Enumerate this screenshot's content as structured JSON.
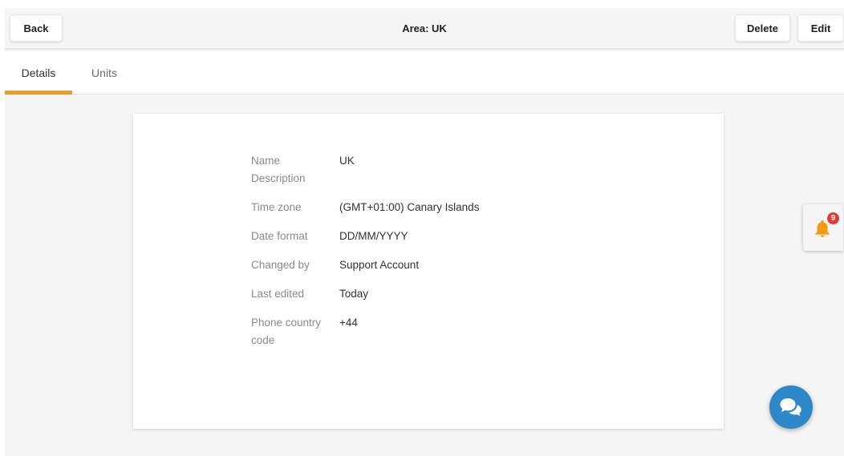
{
  "header": {
    "back_label": "Back",
    "title": "Area: UK",
    "delete_label": "Delete",
    "edit_label": "Edit"
  },
  "tabs": [
    {
      "label": "Details",
      "active": true
    },
    {
      "label": "Units",
      "active": false
    }
  ],
  "details": {
    "name": {
      "label": "Name",
      "value": "UK"
    },
    "description": {
      "label": "Description",
      "value": ""
    },
    "time_zone": {
      "label": "Time zone",
      "value": "(GMT+01:00) Canary Islands"
    },
    "date_format": {
      "label": "Date format",
      "value": "DD/MM/YYYY"
    },
    "changed_by": {
      "label": "Changed by",
      "value": "Support Account"
    },
    "last_edited": {
      "label": "Last edited",
      "value": "Today"
    },
    "phone_country_code": {
      "label": "Phone country code",
      "value": "+44"
    }
  },
  "notifications": {
    "count": "9",
    "icon": "bell-icon"
  },
  "chat": {
    "icon": "chat-bubbles-icon"
  },
  "colors": {
    "accent": "#f39c12",
    "badge": "#e53935",
    "chat": "#2e88c7"
  }
}
